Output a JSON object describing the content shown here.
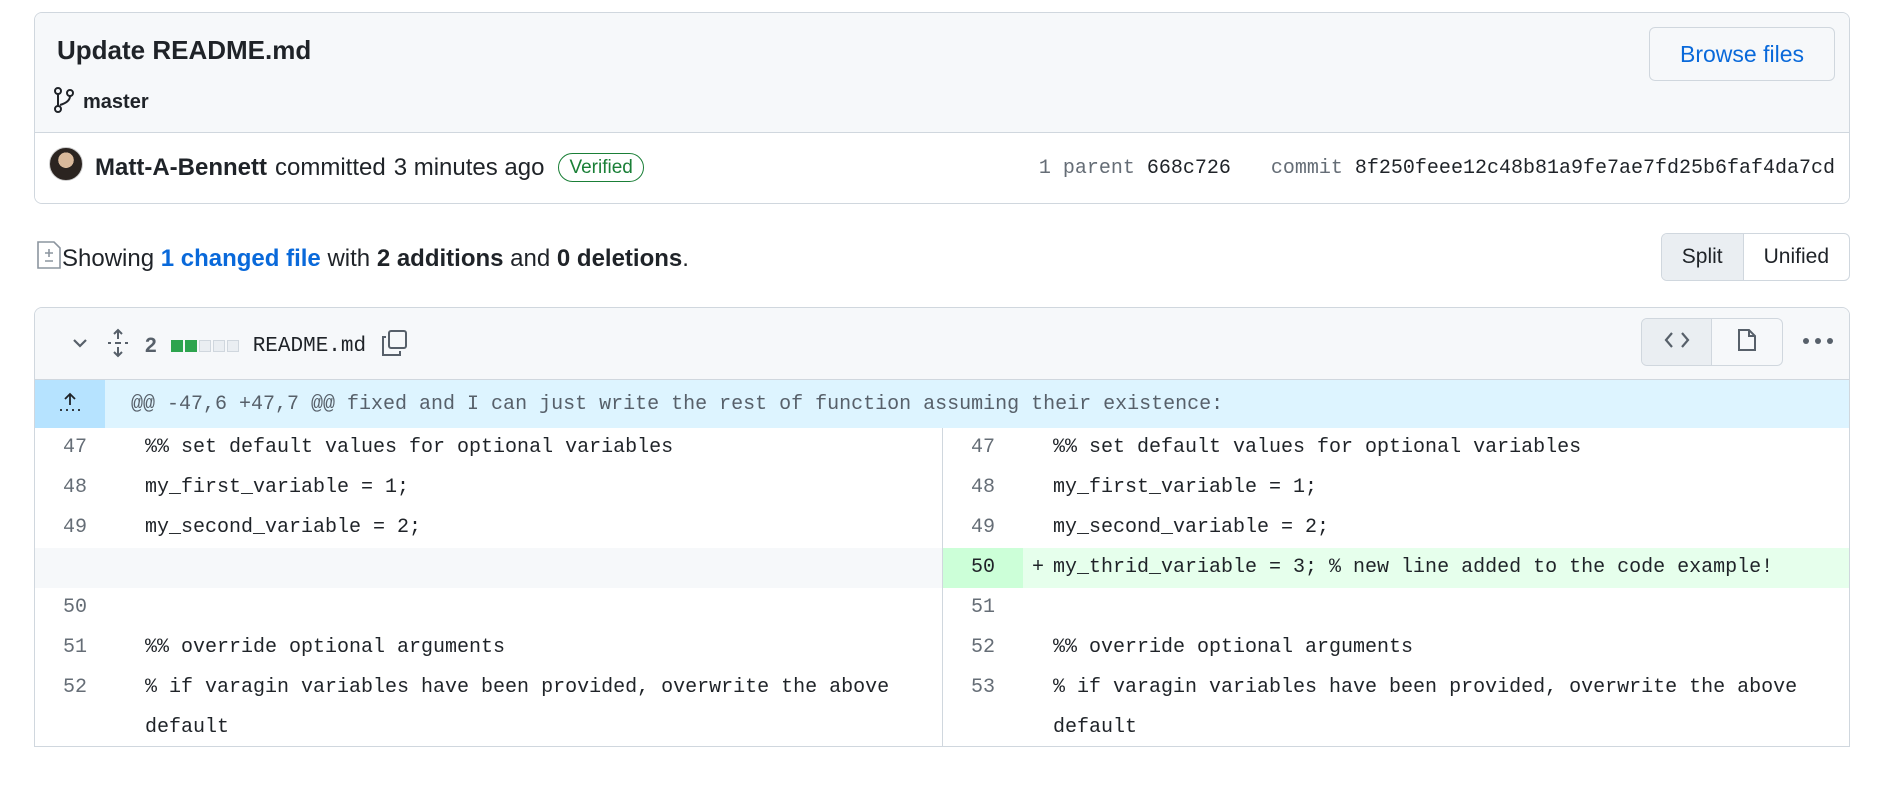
{
  "commit": {
    "title": "Update README.md",
    "branch": "master",
    "browse_label": "Browse files",
    "author": "Matt-A-Bennett",
    "action": "committed",
    "time": "3 minutes ago",
    "verified": "Verified",
    "parent_label": "1 parent",
    "parent_sha": "668c726",
    "commit_label": "commit",
    "commit_sha": "8f250feee12c48b81a9fe7ae7fd25b6faf4da7cd"
  },
  "summary": {
    "showing": "Showing",
    "changed_files": "1 changed file",
    "with": "with",
    "additions": "2 additions",
    "and": "and",
    "deletions": "0 deletions",
    "period": "."
  },
  "view": {
    "split": "Split",
    "unified": "Unified"
  },
  "file": {
    "count": "2",
    "name": "README.md",
    "diffstat": [
      "add",
      "add",
      "none",
      "none",
      "none"
    ]
  },
  "hunk": "@@ -47,6 +47,7 @@ fixed and I can just write the rest of function assuming their existence:",
  "rows": [
    {
      "l": "47",
      "lc": "%% set default values for optional variables",
      "r": "47",
      "rc": "%% set default values for optional variables",
      "type": "ctx"
    },
    {
      "l": "48",
      "lc": "my_first_variable = 1;",
      "r": "48",
      "rc": "my_first_variable = 1;",
      "type": "ctx"
    },
    {
      "l": "49",
      "lc": "my_second_variable = 2;",
      "r": "49",
      "rc": "my_second_variable = 2;",
      "type": "ctx"
    },
    {
      "l": "",
      "lc": "",
      "r": "50",
      "rc": "my_thrid_variable = 3; % new line added to the code example!",
      "type": "add",
      "sign": "+"
    },
    {
      "l": "50",
      "lc": "",
      "r": "51",
      "rc": "",
      "type": "ctx"
    },
    {
      "l": "51",
      "lc": "%% override optional arguments",
      "r": "52",
      "rc": "%% override optional arguments",
      "type": "ctx"
    },
    {
      "l": "52",
      "lc": "% if varagin variables have been provided, overwrite the above default",
      "r": "53",
      "rc": "% if varagin variables have been provided, overwrite the above default",
      "type": "ctx",
      "tall": true
    }
  ],
  "colors": {
    "link": "#0969da",
    "added_bg": "#e6ffec",
    "added_ln": "#ccffd8",
    "hunk_bg": "#ddf4ff",
    "verified": "#1a7f37"
  }
}
